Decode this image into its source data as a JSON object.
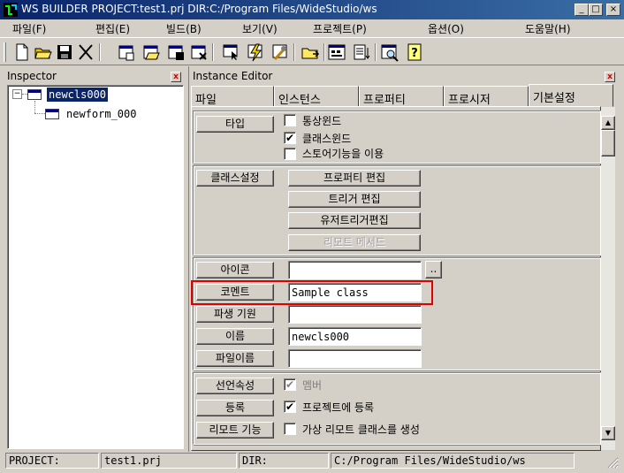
{
  "window": {
    "title": "WS BUILDER PROJECT:test1.prj DIR:C:/Program Files/WideStudio/ws",
    "minimize_label": "_",
    "maximize_label": "□",
    "close_label": "×"
  },
  "menu": [
    "파일(F)",
    "편집(E)",
    "빌드(B)",
    "보기(V)",
    "프로젝트(P)",
    "옵션(O)",
    "도움말(H)"
  ],
  "toolbar": {
    "buttons": [
      "new-file-icon",
      "open-folder-icon",
      "save-icon",
      "cut-icon",
      "new-window-icon",
      "open-window-icon",
      "save-window-icon",
      "close-window-icon",
      "select-icon",
      "lightning-icon",
      "build-icon",
      "folder-arrow-icon",
      "dialog-icon",
      "list-icon",
      "preview-icon",
      "help-icon"
    ]
  },
  "inspector": {
    "title": "Inspector",
    "close_label": "x",
    "tree": [
      {
        "label": "newcls000",
        "selected": true,
        "expander": "⊟"
      },
      {
        "label": "newform_000",
        "selected": false
      }
    ]
  },
  "instance_editor": {
    "title": "Instance Editor",
    "close_label": "x",
    "tabs": [
      "파일",
      "인스턴스",
      "프로퍼티",
      "프로시저",
      "기본설정"
    ],
    "type_button": "타입",
    "type_options": [
      {
        "label": "통상윈드",
        "checked": false,
        "enabled": true
      },
      {
        "label": "클래스윈드",
        "checked": true,
        "enabled": true
      },
      {
        "label": "스토어기능을 이용",
        "checked": false,
        "enabled": true
      }
    ],
    "class_settings_button": "클래스설정",
    "class_settings_actions": [
      {
        "label": "프로퍼티 편집",
        "enabled": true
      },
      {
        "label": "트리거 편집",
        "enabled": true
      },
      {
        "label": "유저트리거편집",
        "enabled": true
      },
      {
        "label": "리모트 메서드",
        "enabled": false
      }
    ],
    "fields": [
      {
        "button": "아이콘",
        "value": "",
        "has_browse": true,
        "browse_label": "..",
        "highlighted": false
      },
      {
        "button": "코멘트",
        "value": "Sample class",
        "has_browse": false,
        "highlighted": true
      },
      {
        "button": "파생 기원",
        "value": "",
        "has_browse": false,
        "highlighted": false
      },
      {
        "button": "이름",
        "value": "newcls000",
        "has_browse": false,
        "highlighted": false
      },
      {
        "button": "파일이름",
        "value": "",
        "has_browse": false,
        "highlighted": false
      }
    ],
    "bottom_options": [
      {
        "button": "선언속성",
        "label": "멤버",
        "checked": true,
        "enabled": false
      },
      {
        "button": "등록",
        "label": "프로젝트에 등록",
        "checked": true,
        "enabled": true
      },
      {
        "button": "리모트 기능",
        "label": "가상 리모트 클래스를 생성",
        "checked": false,
        "enabled": true
      }
    ],
    "scrollbar": {
      "up_label": "▲",
      "down_label": "▼"
    }
  },
  "statusbar": {
    "project_label": "PROJECT:",
    "project_value": "test1.prj",
    "dir_label": "DIR:",
    "dir_value": "C:/Program Files/WideStudio/ws"
  },
  "colors": {
    "title_gradient_start": "#0a246a",
    "title_gradient_end": "#3a6ea5",
    "selection": "#0a246a",
    "highlight_box": "#e00000",
    "face": "#d4d0c8"
  }
}
